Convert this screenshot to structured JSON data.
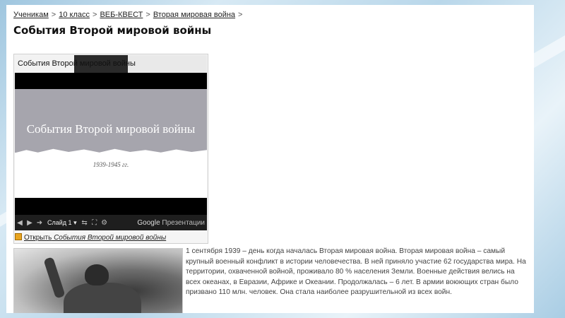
{
  "breadcrumb": {
    "items": [
      "Ученикам",
      "10 класс",
      "ВЕБ-КВЕСТ",
      "Вторая мировая война"
    ],
    "separator": ">"
  },
  "page_title": "События Второй мировой войны",
  "embed": {
    "header_title": "События Второй мировой войны",
    "slide_title": "События Второй мировой войны",
    "slide_years": "1939-1945 гг.",
    "controls": {
      "slide_label": "Слайд 1",
      "brand": "Google",
      "brand_suffix": "Презентации"
    },
    "open_link_prefix": "Открыть",
    "open_link_name": "События Второй мировой войны"
  },
  "article_text": "1 сентября 1939 – день когда началась Вторая мировая война. Вторая мировая война – самый крупный военный конфликт в истории человечества. В ней приняло участие 62 государства мира. На территории, охваченной войной, проживало 80 % населения Земли. Военные действия велись на всех океанах, в Евразии, Африке и Океании. Продолжалась – 6 лет. В армии воюющих стран было призвано 110 млн. человек. Она стала наиболее разрушительной из всех войн."
}
